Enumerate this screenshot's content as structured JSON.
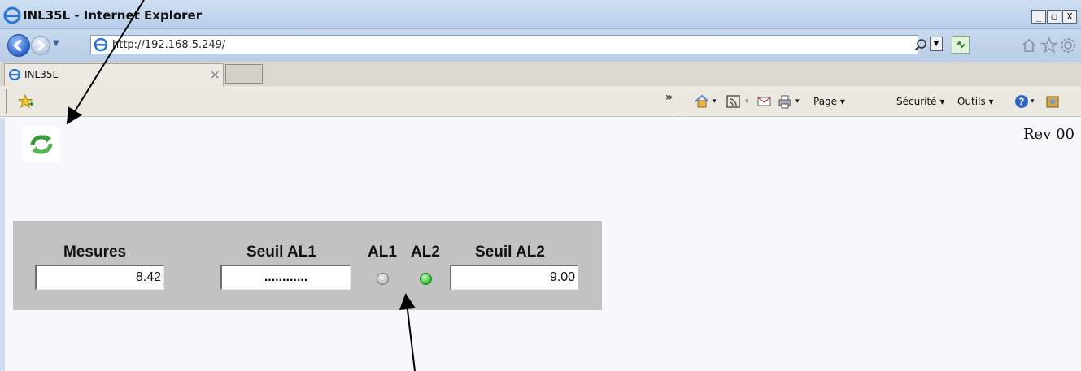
{
  "window": {
    "title": "INL35L - Internet Explorer",
    "minimize": "_",
    "maximize": "□",
    "close": "X"
  },
  "address": {
    "url": "http://192.168.5.249/"
  },
  "tab": {
    "label": "INL35L",
    "close": "×"
  },
  "commandbar": {
    "overflow": "»",
    "page": "Page ▾",
    "security": "Sécurité ▾",
    "tools": "Outils ▾"
  },
  "page": {
    "revision": "Rev 00",
    "panel": {
      "mesures_label": "Mesures",
      "mesures_value": "8.42",
      "seuil_al1_label": "Seuil AL1",
      "seuil_al1_value": "............",
      "al1_label": "AL1",
      "al2_label": "AL2",
      "seuil_al2_label": "Seuil AL2",
      "seuil_al2_value": "9.00",
      "al1_state": "off",
      "al2_state": "on"
    }
  },
  "colors": {
    "led_off": "#bdbdbd",
    "led_on": "#3cc23c",
    "panel_bg": "#c2c2c2"
  },
  "icons": [
    "ie-icon",
    "back-icon",
    "forward-icon",
    "search-icon",
    "compat-icon",
    "home-icon",
    "star-icon",
    "gear-icon",
    "favorites-icon",
    "rss-icon",
    "mail-icon",
    "print-icon",
    "help-icon",
    "refresh-icon"
  ]
}
